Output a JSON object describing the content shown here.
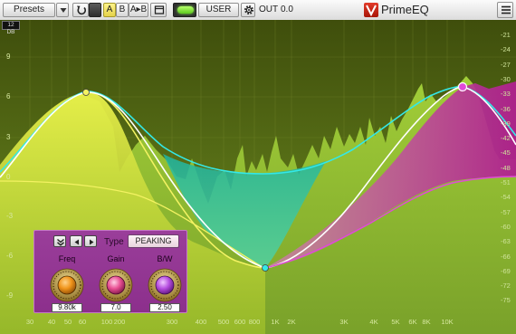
{
  "colors": {
    "accent_yellow": "#f2f24a",
    "accent_cyan": "#32e8e8",
    "accent_magenta": "#e04ad8",
    "panel": "#8c2f8c",
    "bg_top": "#4a5a12",
    "bg_bottom": "#6f8f2a"
  },
  "toolbar": {
    "presets_label": "Presets",
    "dropdown_icon": "triangle-down",
    "undo_icon": "undo-arrow",
    "ab_a": "A",
    "ab_b": "B",
    "ab_swap": "A▸B",
    "compare_icon": "save-slot",
    "bypass_icon": "power-led",
    "preset_name": "USER",
    "settings_icon": "gear",
    "out_label": "OUT",
    "out_value": "0.0",
    "brand": "PrimeEQ",
    "menu_icon": "hamburger"
  },
  "graph": {
    "range_badge": "12 DB",
    "db_left_labels": [
      "9",
      "6",
      "3",
      "0",
      "-3",
      "-6",
      "-9"
    ],
    "db_right_labels": [
      "-21",
      "-24",
      "-27",
      "-30",
      "-33",
      "-36",
      "-39",
      "-42",
      "-45",
      "-48",
      "-51",
      "-54",
      "-57",
      "-60",
      "-63",
      "-66",
      "-69",
      "-72",
      "-75"
    ],
    "freq_labels": [
      "30",
      "40",
      "50",
      "60",
      "100",
      "200",
      "300",
      "400",
      "500",
      "600",
      "800",
      "1K",
      "2K",
      "3K",
      "4K",
      "5K",
      "6K",
      "8K",
      "10K"
    ]
  },
  "band": {
    "type_label": "Type",
    "type_value": "PEAKING",
    "freq_label": "Freq",
    "freq_value": "9.80k",
    "gain_label": "Gain",
    "gain_value": "7.0",
    "bw_label": "B/W",
    "bw_value": "2.50"
  }
}
